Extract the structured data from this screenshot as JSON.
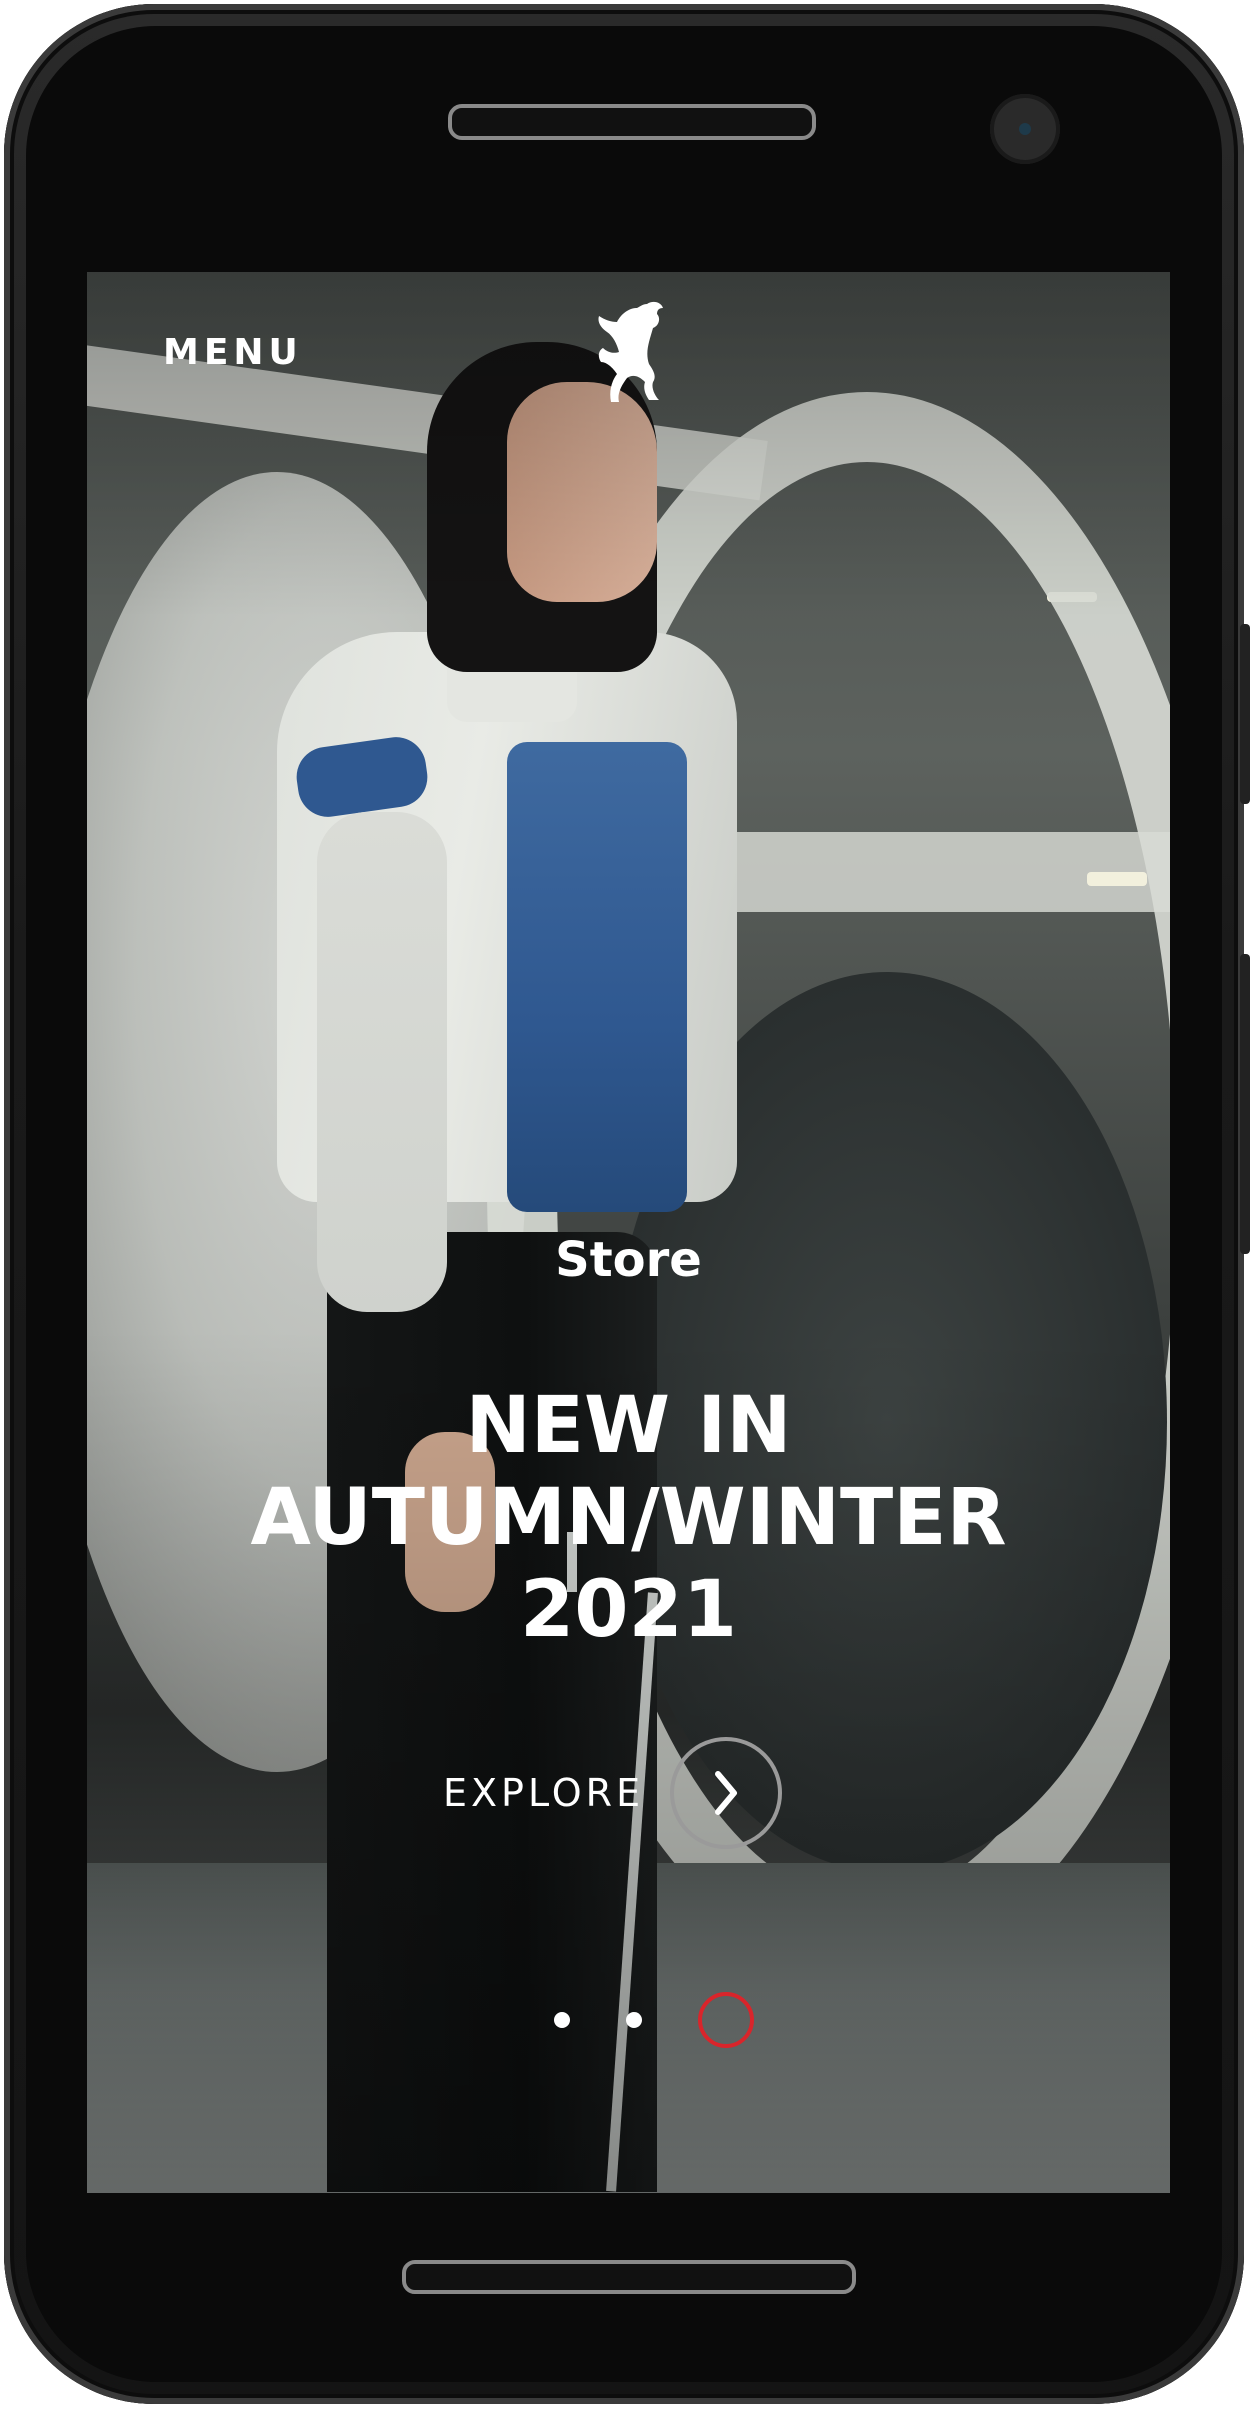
{
  "header": {
    "menu_label": "MENU",
    "logo_icon": "prancing-horse-icon"
  },
  "hero": {
    "kicker": "Store",
    "headline_lines": [
      "NEW IN",
      "AUTUMN/WINTER",
      "2021"
    ],
    "cta_label": "EXPLORE",
    "cta_icon": "chevron-right-icon"
  },
  "carousel": {
    "slides": 3,
    "active_index": 2,
    "active_color": "#d9252b"
  },
  "device": {
    "frame_color": "#1a1a1a"
  }
}
